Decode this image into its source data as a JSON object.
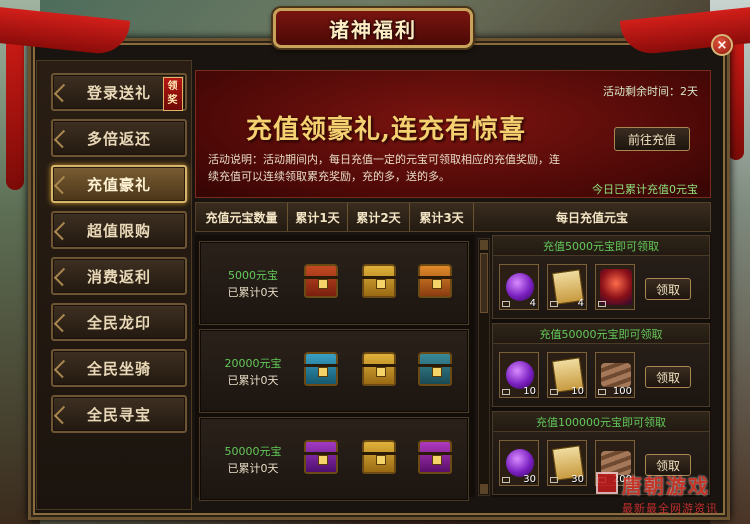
{
  "window": {
    "title": "诸神福利",
    "close_label": "×"
  },
  "sidebar": {
    "items": [
      {
        "label": "登录送礼",
        "badge": "领奖"
      },
      {
        "label": "多倍返还"
      },
      {
        "label": "充值豪礼",
        "active": true
      },
      {
        "label": "超值限购"
      },
      {
        "label": "消费返利"
      },
      {
        "label": "全民龙印"
      },
      {
        "label": "全民坐骑"
      },
      {
        "label": "全民寻宝"
      }
    ]
  },
  "banner": {
    "time_left": "活动剩余时间：2天",
    "slogan": "充值领豪礼,连充有惊喜",
    "goto_button": "前往充值",
    "description": "活动说明：活动期间内，每日充值一定的元宝可领取相应的充值奖励，连续充值可以连续领取累充奖励，充的多，送的多。",
    "total": "今日已累计充值0元宝"
  },
  "table_header": {
    "columns": [
      "充值元宝数量",
      "累计1天",
      "累计2天",
      "累计3天",
      "每日充值元宝"
    ]
  },
  "tiers": [
    {
      "amount": "5000元宝",
      "days": "已累计0天",
      "chest_colors": [
        "#a0321a",
        "#c8911f",
        "#c8631a"
      ]
    },
    {
      "amount": "20000元宝",
      "days": "已累计0天",
      "chest_colors": [
        "#1f7a9a",
        "#c89a2a",
        "#2a6a7a"
      ]
    },
    {
      "amount": "50000元宝",
      "days": "已累计0天",
      "chest_colors": [
        "#7a1fa0",
        "#c89a2a",
        "#8a1a9a"
      ]
    }
  ],
  "rewards": [
    {
      "title": "充值5000元宝即可领取",
      "items": [
        {
          "icon": "purple-orb-icon",
          "qty": "4"
        },
        {
          "icon": "scroll-icon",
          "qty": "4"
        },
        {
          "icon": "character-icon",
          "qty": ""
        }
      ],
      "button": "领取"
    },
    {
      "title": "充值50000元宝即可领取",
      "items": [
        {
          "icon": "purple-orb-icon",
          "qty": "10"
        },
        {
          "icon": "scroll-icon",
          "qty": "10"
        },
        {
          "icon": "wood-icon",
          "qty": "100"
        }
      ],
      "button": "领取"
    },
    {
      "title": "充值100000元宝即可领取",
      "items": [
        {
          "icon": "purple-orb-icon",
          "qty": "30"
        },
        {
          "icon": "scroll-icon",
          "qty": "30"
        },
        {
          "icon": "wood-icon",
          "qty": "200"
        }
      ],
      "button": "领取"
    }
  ],
  "watermark": {
    "line1": "唐朝游戏",
    "line2": "最新最全网游资讯"
  }
}
